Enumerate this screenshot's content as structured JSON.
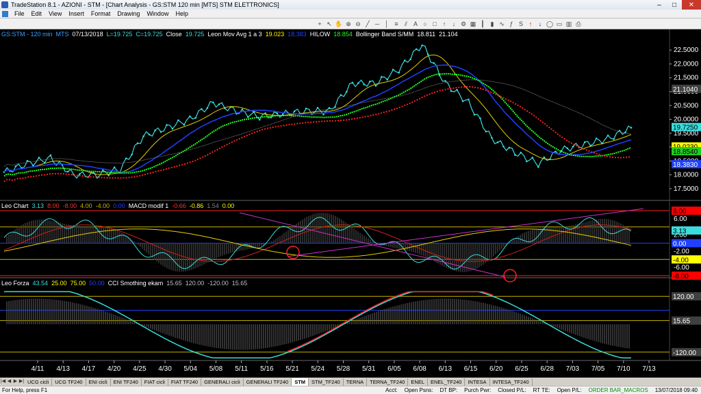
{
  "window": {
    "title": "TradeStation 8.1 - AZIONI - STM - [Chart Analysis - GS:STM  120 min  [MTS] STM ELETTRONICS]"
  },
  "menu": [
    "File",
    "Edit",
    "View",
    "Insert",
    "Format",
    "Drawing",
    "Window",
    "Help"
  ],
  "price_pane": {
    "header": [
      {
        "text": "GS:STM - 120 min",
        "color": "#3aa0ff"
      },
      {
        "text": "MTS",
        "color": "#3aa0ff"
      },
      {
        "text": "07/13/2018",
        "color": "#ffffff"
      },
      {
        "text": "L=19.725",
        "color": "#3cdcdc"
      },
      {
        "text": "C=19.725",
        "color": "#3cdcdc"
      },
      {
        "text": "Close",
        "color": "#ffffff"
      },
      {
        "text": "19.725",
        "color": "#3cdcdc"
      },
      {
        "text": "Leon Mov Avg 1 a 3",
        "color": "#ffffff"
      },
      {
        "text": "19.023",
        "color": "#ffff00"
      },
      {
        "text": "18.383",
        "color": "#2040ff"
      },
      {
        "text": "HILOW",
        "color": "#ffffff"
      },
      {
        "text": "18.854",
        "color": "#22ff22"
      },
      {
        "text": "Bollinger Band S/MM",
        "color": "#ffffff"
      },
      {
        "text": "18.811",
        "color": "#ffffff"
      },
      {
        "text": "21.104",
        "color": "#ffffff"
      }
    ],
    "axis_ticks": [
      "22.5000",
      "22.0000",
      "21.5000",
      "21.0000",
      "20.5000",
      "20.0000",
      "19.5000",
      "19.0000",
      "18.5000",
      "18.0000",
      "17.5000"
    ],
    "axis_range": [
      17.2,
      22.9
    ],
    "boxes": [
      {
        "text": "21.1040",
        "value": 21.104,
        "bg": "#404040",
        "fg": "#ffffff"
      },
      {
        "text": "19.7250",
        "value": 19.725,
        "bg": "#3cdcdc",
        "fg": "#000000"
      },
      {
        "text": "19.0230",
        "value": 19.023,
        "bg": "#ffff00",
        "fg": "#000000"
      },
      {
        "text": "18.8540",
        "value": 18.854,
        "bg": "#22cc22",
        "fg": "#000000"
      },
      {
        "text": "18.3830",
        "value": 18.383,
        "bg": "#2040ff",
        "fg": "#ffffff"
      }
    ]
  },
  "macd_pane": {
    "header": [
      {
        "text": "Leo Chart",
        "color": "#ffffff"
      },
      {
        "text": "3.13",
        "color": "#3cdcdc"
      },
      {
        "text": "8.00",
        "color": "#ff3030"
      },
      {
        "text": "-8.00",
        "color": "#ff3030"
      },
      {
        "text": "4.00",
        "color": "#c8b400"
      },
      {
        "text": "-4.00",
        "color": "#c8b400"
      },
      {
        "text": "0.00",
        "color": "#2040ff"
      },
      {
        "text": "MACD modif 1",
        "color": "#ffffff"
      },
      {
        "text": "-0.66",
        "color": "#ff3030"
      },
      {
        "text": "-0.86",
        "color": "#ffff00"
      },
      {
        "text": "1.54",
        "color": "#808080"
      },
      {
        "text": "0.00",
        "color": "#ffff00"
      }
    ],
    "axis_ticks": [
      "6.00",
      "2.00",
      "-2.00",
      "-6.00"
    ],
    "boxes": [
      {
        "text": "8.00",
        "value": 8,
        "bg": "#ff0000",
        "fg": "#000000"
      },
      {
        "text": "3.13",
        "value": 3.13,
        "bg": "#3cdcdc",
        "fg": "#000000"
      },
      {
        "text": "0.00",
        "value": 0,
        "bg": "#2040ff",
        "fg": "#ffffff"
      },
      {
        "text": "-4.00",
        "value": -4,
        "bg": "#ffff00",
        "fg": "#000000"
      },
      {
        "text": "-8.00",
        "value": -8,
        "bg": "#ff0000",
        "fg": "#000000"
      }
    ]
  },
  "forza_pane": {
    "header": [
      {
        "text": "Leo Forza",
        "color": "#ffffff"
      },
      {
        "text": "43.54",
        "color": "#3cdcdc"
      },
      {
        "text": "25.00",
        "color": "#ffff00"
      },
      {
        "text": "75.00",
        "color": "#ffff00"
      },
      {
        "text": "50.00",
        "color": "#2040ff"
      },
      {
        "text": "CCI Smothing ekam",
        "color": "#ffffff"
      },
      {
        "text": "15.65",
        "color": "#c0c0c0"
      },
      {
        "text": "120.00",
        "color": "#c0c0c0"
      },
      {
        "text": "-120.00",
        "color": "#c0c0c0"
      },
      {
        "text": "15.65",
        "color": "#c0c0c0"
      }
    ],
    "boxes": [
      {
        "text": "120.00",
        "row": 0,
        "bg": "#404040",
        "fg": "#ffffff"
      },
      {
        "text": "15.65",
        "row": 1,
        "bg": "#404040",
        "fg": "#ffffff"
      },
      {
        "text": "-120.00",
        "row": 2,
        "bg": "#404040",
        "fg": "#ffffff"
      }
    ]
  },
  "x_axis": [
    "4/11",
    "4/13",
    "4/17",
    "4/20",
    "4/25",
    "4/30",
    "5/04",
    "5/08",
    "5/11",
    "5/16",
    "5/21",
    "5/24",
    "5/28",
    "5/31",
    "6/05",
    "6/08",
    "6/13",
    "6/15",
    "6/20",
    "6/25",
    "6/28",
    "7/03",
    "7/05",
    "7/10",
    "7/13"
  ],
  "tabs": [
    "UCG cicli",
    "UCG TF240",
    "ENI cicli",
    "ENI TF240",
    "FIAT cicli",
    "FIAT TF240",
    "GENERALI cicli",
    "GENERALI TF240",
    "STM",
    "STM_TF240",
    "TERNA",
    "TERNA_TF240",
    "ENEL",
    "ENEL_TF240",
    "INTESA",
    "INTESA_TF240"
  ],
  "active_tab": "STM",
  "status": {
    "help": "For Help, press F1",
    "items": [
      "Acct:",
      "Open Psns:",
      "DT BP:",
      "Purch Pwr:",
      "Closed P/L:",
      "RT TE:",
      "Open P/L:"
    ],
    "macros": "ORDER BAR_MACROS",
    "datetime": "13/07/2018 09:40"
  },
  "chart_data": {
    "type": "line",
    "x_labels": [
      "4/11",
      "4/13",
      "4/17",
      "4/20",
      "4/25",
      "4/30",
      "5/04",
      "5/08",
      "5/11",
      "5/16",
      "5/21",
      "5/24",
      "5/28",
      "5/31",
      "6/05",
      "6/08",
      "6/13",
      "6/15",
      "6/20",
      "6/25",
      "6/28",
      "7/03",
      "7/05",
      "7/10",
      "7/13"
    ],
    "close": [
      18.1,
      18.4,
      18.6,
      18.0,
      18.0,
      18.2,
      19.4,
      19.7,
      20.0,
      20.6,
      20.3,
      20.1,
      20.2,
      20.3,
      20.3,
      21.3,
      21.3,
      21.8,
      22.7,
      21.3,
      20.6,
      19.3,
      18.8,
      18.4,
      18.9,
      19.1,
      19.3,
      19.7
    ]
  }
}
